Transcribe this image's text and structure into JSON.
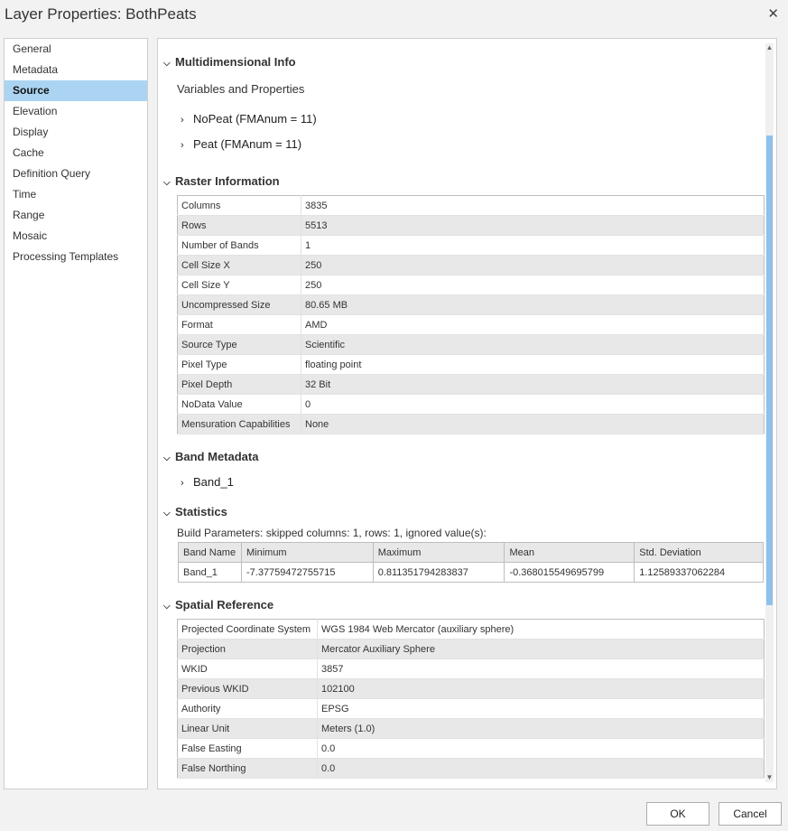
{
  "window": {
    "title": "Layer Properties: BothPeats",
    "close_glyph": "✕"
  },
  "nav": {
    "items": [
      {
        "label": "General"
      },
      {
        "label": "Metadata"
      },
      {
        "label": "Source",
        "active": true
      },
      {
        "label": "Elevation"
      },
      {
        "label": "Display"
      },
      {
        "label": "Cache"
      },
      {
        "label": "Definition Query"
      },
      {
        "label": "Time"
      },
      {
        "label": "Range"
      },
      {
        "label": "Mosaic"
      },
      {
        "label": "Processing Templates"
      }
    ]
  },
  "multidim": {
    "title": "Multidimensional Info",
    "subtitle": "Variables and Properties",
    "variables": [
      "NoPeat (FMAnum = 11)",
      "Peat (FMAnum = 11)"
    ]
  },
  "raster": {
    "title": "Raster Information",
    "rows": [
      [
        "Columns",
        "3835"
      ],
      [
        "Rows",
        "5513"
      ],
      [
        "Number of Bands",
        "1"
      ],
      [
        "Cell Size X",
        "250"
      ],
      [
        "Cell Size Y",
        "250"
      ],
      [
        "Uncompressed Size",
        "80.65 MB"
      ],
      [
        "Format",
        "AMD"
      ],
      [
        "Source Type",
        "Scientific"
      ],
      [
        "Pixel Type",
        "floating point"
      ],
      [
        "Pixel Depth",
        "32 Bit"
      ],
      [
        "NoData Value",
        "0"
      ],
      [
        "Mensuration Capabilities",
        "None"
      ]
    ]
  },
  "band_metadata": {
    "title": "Band Metadata",
    "bands": [
      "Band_1"
    ]
  },
  "statistics": {
    "title": "Statistics",
    "build_params": "Build Parameters: skipped columns: 1, rows: 1, ignored value(s):",
    "headers": [
      "Band Name",
      "Minimum",
      "Maximum",
      "Mean",
      "Std. Deviation"
    ],
    "rows": [
      [
        "Band_1",
        "-7.37759472755715",
        "0.811351794283837",
        "-0.368015549695799",
        "1.12589337062284"
      ]
    ]
  },
  "spatial": {
    "title": "Spatial Reference",
    "rows": [
      [
        "Projected Coordinate System",
        "WGS 1984 Web Mercator (auxiliary sphere)"
      ],
      [
        "Projection",
        "Mercator Auxiliary Sphere"
      ],
      [
        "WKID",
        "3857"
      ],
      [
        "Previous WKID",
        "102100"
      ],
      [
        "Authority",
        "EPSG"
      ],
      [
        "Linear Unit",
        "Meters (1.0)"
      ],
      [
        "False Easting",
        "0.0"
      ],
      [
        "False Northing",
        "0.0"
      ]
    ]
  },
  "buttons": {
    "ok": "OK",
    "cancel": "Cancel"
  }
}
